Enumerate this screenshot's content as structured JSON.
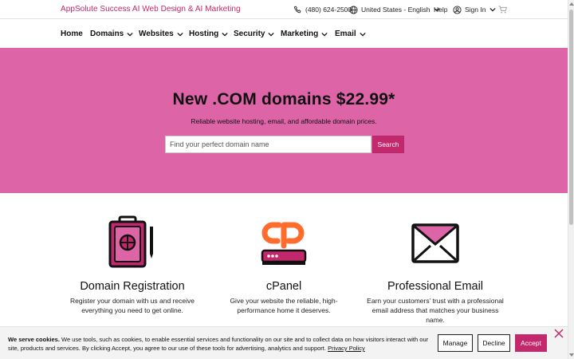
{
  "topbar": {
    "brand": "AppSolute Success AI Web Design & AI Marketing",
    "phone": "(480) 624-2500",
    "region": "United States - English",
    "help": "Help",
    "sign_in": "Sign In"
  },
  "nav": {
    "items": [
      {
        "label": "Home",
        "has_dropdown": false
      },
      {
        "label": "Domains",
        "has_dropdown": true
      },
      {
        "label": "Websites",
        "has_dropdown": true
      },
      {
        "label": "Hosting",
        "has_dropdown": true
      },
      {
        "label": "Security",
        "has_dropdown": true
      },
      {
        "label": "Marketing",
        "has_dropdown": true
      },
      {
        "label": "Email",
        "has_dropdown": true
      }
    ]
  },
  "hero": {
    "title": "New .COM domains $22.99*",
    "subtitle": "Reliable website hosting, email, and affordable domain prices.",
    "search_placeholder": "Find your perfect domain name",
    "search_button": "Search"
  },
  "features": [
    {
      "icon": "domain-registration-icon",
      "title": "Domain Registration",
      "desc": "Register your domain with us and receive everything you need to get online."
    },
    {
      "icon": "cpanel-icon",
      "title": "cPanel",
      "desc": "Give your website the reliable, high-performance home it deserves."
    },
    {
      "icon": "envelope-icon",
      "title": "Professional Email",
      "desc": "Earn your customers’ trust with a professional email address that matches your business name."
    }
  ],
  "cookie": {
    "heading": "We serve cookies.",
    "body": "We use tools, such as cookies, to enable essential services and functionality on our site and to collect data on how visitors interact with our site, products and services. By clicking Accept, you agree to our use of these tools for advertising, analytics and support.",
    "privacy_link": "Privacy Policy",
    "manage": "Manage",
    "decline": "Decline",
    "accept": "Accept"
  },
  "colors": {
    "brand": "#c2286b",
    "hero_bg": "#de64a8",
    "cpanel_orange": "#ff6c2c",
    "cookie_bg": "#f3f3f3"
  }
}
